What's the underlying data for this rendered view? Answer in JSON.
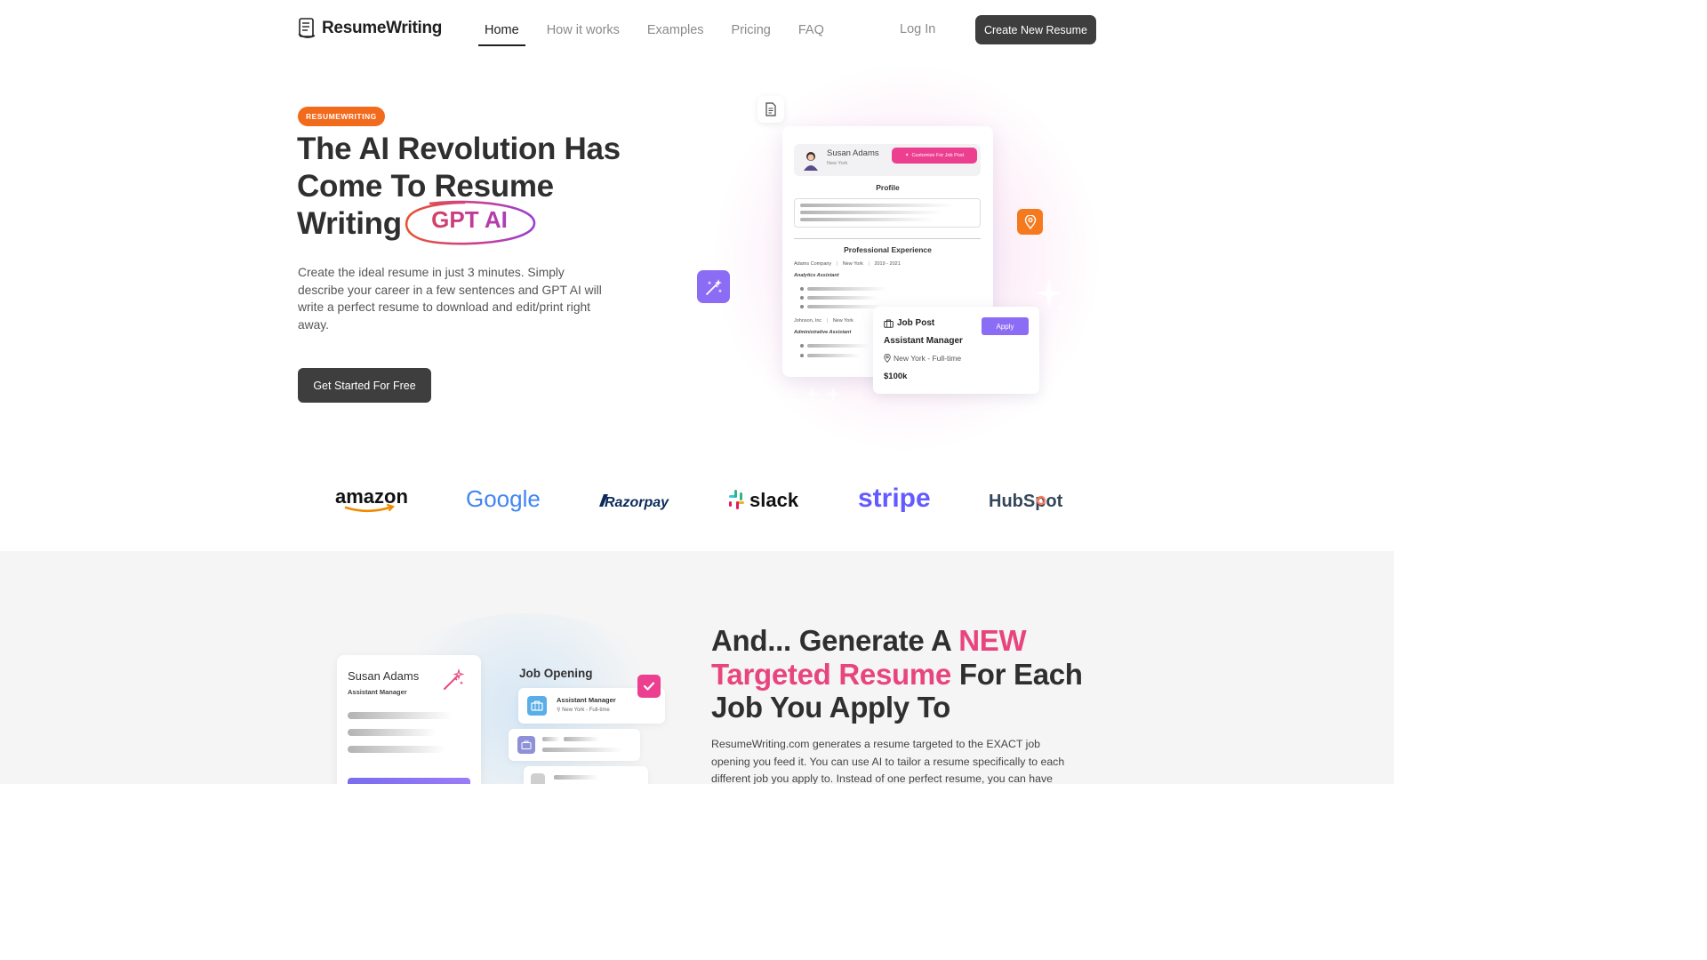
{
  "header": {
    "logo_text": "ResumeWriting",
    "nav": [
      {
        "label": "Home",
        "active": true
      },
      {
        "label": "How it works",
        "active": false
      },
      {
        "label": "Examples",
        "active": false
      },
      {
        "label": "Pricing",
        "active": false
      },
      {
        "label": "FAQ",
        "active": false
      }
    ],
    "login_label": "Log In",
    "create_label": "Create New Resume"
  },
  "hero": {
    "badge": "RESUMEWRITING",
    "title": "The AI Revolution Has Come To Resume Writing",
    "highlight": "GPT AI",
    "description": "Create the ideal resume in just 3 minutes. Simply describe your career in a few sentences and GPT AI will write a perfect resume to download and edit/print right away.",
    "cta_label": "Get Started For Free"
  },
  "illustration": {
    "resume_name": "Susan Adams",
    "resume_city": "New York",
    "customize_label": "Customize For Job Post",
    "profile_heading": "Profile",
    "experience_heading": "Professional Experience",
    "job1_company": "Adams Company",
    "job1_city": "New York",
    "job1_years": "2019 - 2021",
    "job1_role": "Analytics Assistant",
    "job2_company": "Johnson, Inc",
    "job2_city": "New York",
    "job2_role": "Administrative Assistant",
    "job_post_title": "Job Post",
    "apply_label": "Apply",
    "job_post_role": "Assistant Manager",
    "job_post_location": "New York - Full-time",
    "job_post_salary": "$100k"
  },
  "logos": [
    "amazon",
    "Google",
    "Razorpay",
    "slack",
    "stripe",
    "HubSpot"
  ],
  "section2": {
    "card_name": "Susan Adams",
    "card_role": "Assistant Manager",
    "job_opening_label": "Job Opening",
    "job_title": "Assistant Manager",
    "job_location": "New York - Full-time",
    "title_part1": "And... Generate A ",
    "title_highlight": "NEW Targeted Resume",
    "title_part2": " For Each Job You Apply To",
    "description": "ResumeWriting.com generates a resume targeted to the EXACT job opening you feed it. You can use AI to tailor a resume specifically to each different job you apply to. Instead of one perfect resume, you can have"
  },
  "colors": {
    "accent_orange": "#f26a1b",
    "accent_pink": "#e8457e",
    "accent_purple": "#8b6cf5",
    "button_dark": "#3e3e3e"
  }
}
